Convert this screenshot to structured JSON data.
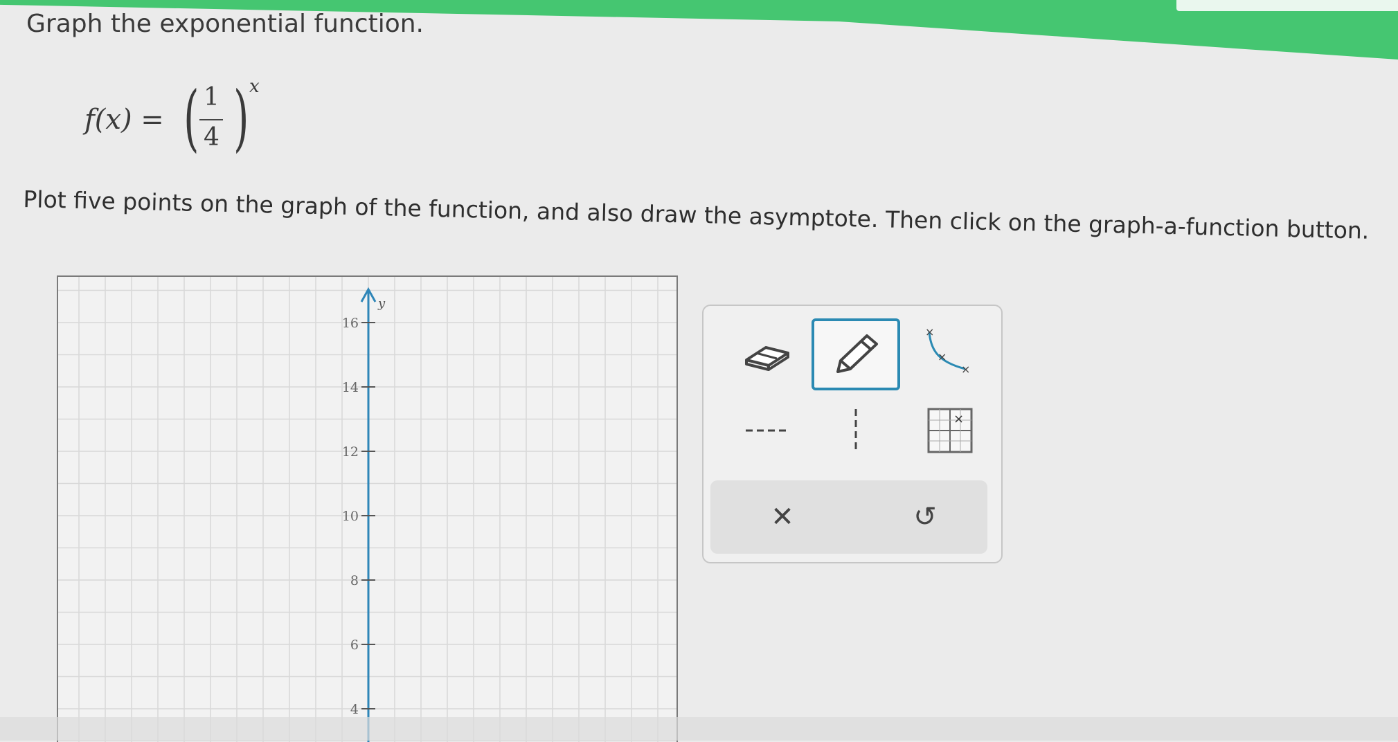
{
  "question": {
    "prompt": "Graph the exponential function.",
    "equation": {
      "lhs": "f(x) =",
      "numerator": "1",
      "denominator": "4",
      "exponent": "x"
    },
    "instruction": "Plot five points on the graph of the function, and also draw the asymptote. Then click on the graph-a-function button."
  },
  "graph": {
    "y_axis_label": "y",
    "y_ticks": [
      "16",
      "14",
      "12",
      "10",
      "8",
      "6",
      "4"
    ],
    "y_range": [
      3,
      17
    ]
  },
  "toolbox": {
    "tools": [
      {
        "name": "eraser-tool",
        "icon": "eraser-icon"
      },
      {
        "name": "pencil-tool",
        "icon": "pencil-icon",
        "selected": true
      },
      {
        "name": "exponential-curve-tool",
        "icon": "exponential-curve-icon"
      },
      {
        "name": "horizontal-asymptote-tool",
        "icon": "horizontal-dashed-line-icon"
      },
      {
        "name": "vertical-asymptote-tool",
        "icon": "vertical-dashed-line-icon"
      },
      {
        "name": "graph-a-function-tool",
        "icon": "graph-grid-icon"
      }
    ],
    "actions": [
      {
        "name": "clear-button",
        "glyph": "✕"
      },
      {
        "name": "undo-button",
        "glyph": "↺"
      }
    ],
    "accent_color": "#2b8ab3"
  },
  "colors": {
    "header_green": "#45c671",
    "axis_blue": "#2f86b8"
  }
}
